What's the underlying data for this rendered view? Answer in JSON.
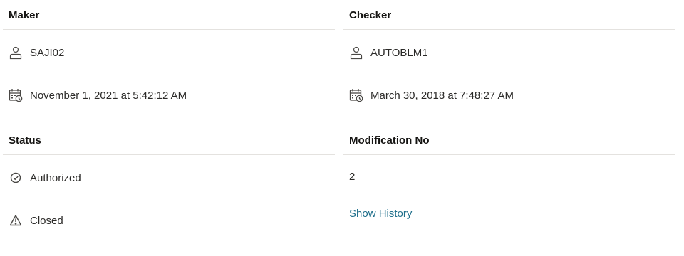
{
  "maker": {
    "title": "Maker",
    "user": "SAJI02",
    "user_icon": "user-icon",
    "date": "November 1, 2021 at 5:42:12 AM",
    "date_icon": "calendar-clock-icon"
  },
  "checker": {
    "title": "Checker",
    "user": "AUTOBLM1",
    "user_icon": "user-icon",
    "date": "March 30, 2018 at 7:48:27 AM",
    "date_icon": "calendar-clock-icon"
  },
  "status": {
    "title": "Status",
    "authorization": "Authorized",
    "authorization_icon": "check-circle-icon",
    "record": "Closed",
    "record_icon": "warning-triangle-icon"
  },
  "modification": {
    "title": "Modification No",
    "number": "2",
    "history_link": "Show History",
    "link_color": "#1f6f8b"
  }
}
